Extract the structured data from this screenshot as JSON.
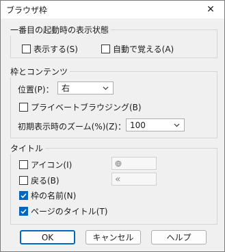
{
  "window": {
    "title": "ブラウザ枠",
    "close_glyph": "✕"
  },
  "startup_group": {
    "title": "一番目の起動時の表示状態",
    "show": {
      "label": "表示する(S)",
      "checked": false
    },
    "auto_remember": {
      "label": "自動で覚える(A)",
      "checked": false
    }
  },
  "frame_group": {
    "title": "枠とコンテンツ",
    "position_label": "位置(P)：",
    "position_value": "右",
    "private_browsing": {
      "label": "プライベートブラウジング(B)",
      "checked": false
    },
    "zoom_label": "初期表示時のズーム(%)(Z)：",
    "zoom_value": "100"
  },
  "title_group": {
    "title": "タイトル",
    "icon": {
      "label": "アイコン(I)",
      "checked": false
    },
    "back": {
      "label": "戻る(B)",
      "checked": false
    },
    "back_preview": "«",
    "frame_name": {
      "label": "枠の名前(N)",
      "checked": true
    },
    "page_title": {
      "label": "ページのタイトル(T)",
      "checked": true
    }
  },
  "buttons": {
    "ok": "OK",
    "cancel": "キャンセル",
    "help": "ヘルプ"
  },
  "colors": {
    "accent": "#0067c0",
    "dialog_bg": "#f0f0f0"
  }
}
